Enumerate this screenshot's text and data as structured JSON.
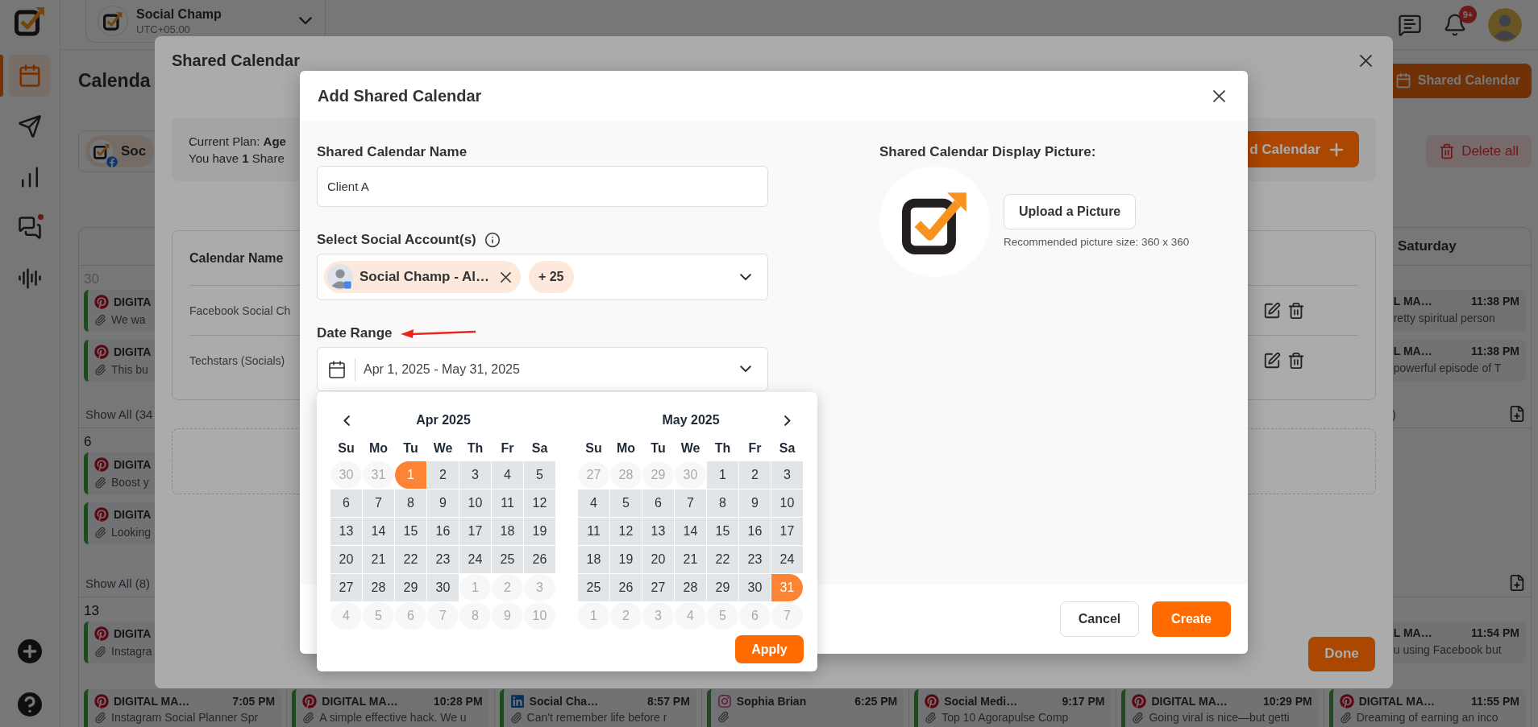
{
  "header": {
    "workspace_name": "Social Champ",
    "timezone": "UTC+05:00",
    "notification_count": "9+"
  },
  "sidebar": {
    "items": [
      {
        "selected": true,
        "unread": false
      },
      {
        "selected": false,
        "unread": false
      },
      {
        "selected": false,
        "unread": false
      },
      {
        "selected": false,
        "unread": true
      },
      {
        "selected": false,
        "unread": false
      }
    ]
  },
  "page": {
    "title": "Calenda",
    "shared_calendar_button": "Shared Calendar",
    "account_label": "Soc",
    "delete_all_button": "Delete all"
  },
  "calendar": {
    "weekday": "Saturday",
    "weeks": [
      {
        "day": "30",
        "outside": true,
        "cells": [
          {
            "posts": [
              {
                "kind": "pinterest",
                "title": "DIGITA",
                "text": "We wa"
              },
              {
                "kind": "pinterest",
                "title": "DIGITA",
                "text": "This bu"
              }
            ],
            "show_all": "Show All (34"
          },
          null,
          null,
          null,
          null,
          null,
          {
            "posts": [
              {
                "kind": "partial",
                "title": "L MA…",
                "time": "11:38 PM",
                "text": "retty spiritual person"
              },
              {
                "kind": "partial",
                "title": "L MA…",
                "time": "11:38 PM",
                "text": "powerful episode of T"
              }
            ],
            "show_all": ")",
            "add_post": true
          }
        ]
      },
      {
        "day": "6",
        "outside": false,
        "cells": [
          {
            "posts": [
              {
                "kind": "pinterest",
                "title": "DIGITA",
                "text": "Boost y"
              },
              {
                "kind": "pinterest",
                "title": "DIGITA",
                "text": "Looking"
              }
            ],
            "show_all": "Show All (8)"
          },
          null,
          null,
          null,
          null,
          null,
          {
            "add_post": true
          }
        ]
      },
      {
        "day": "13",
        "outside": false,
        "cells": [
          {
            "posts": [
              {
                "kind": "pinterest",
                "title": "DIGITA",
                "text": "Instagra"
              }
            ]
          },
          null,
          null,
          null,
          null,
          null,
          {
            "posts": [
              {
                "kind": "partial",
                "title": "L MA…",
                "time": "11:54 PM",
                "text": "u using Facebook but"
              }
            ]
          }
        ],
        "bottom_row": [
          {
            "kind": "pinterest",
            "title": "DIGITAL MA…",
            "time": "7:05 PM",
            "text": "Instagram Social Planner Spr"
          },
          {
            "kind": "pinterest",
            "title": "DIGITAL MA…",
            "time": "10:28 PM",
            "text": "A simple effective hack. We u"
          },
          {
            "kind": "linkedin",
            "title": "Social Cha…",
            "time": "8:57 PM",
            "text": "Can't remember life before r"
          },
          {
            "kind": "instagram",
            "title": "Sophia Brian",
            "time": "6:25 PM"
          },
          {
            "kind": "pinterest",
            "title": "Social Medi…",
            "time": "9:17 PM",
            "text": "Top 10 Agorapulse Comp"
          },
          {
            "kind": "pinterest",
            "title": "DIGITAL MA…",
            "time": "10:29 PM",
            "text": "Going viral is nice—but getti"
          },
          {
            "kind": "pinterest",
            "title": "DIGITAL MA…",
            "time": "11:55 PM",
            "text": "Dreaming of earning an inco"
          }
        ]
      }
    ]
  },
  "shared_calendar_modal": {
    "title": "Shared Calendar",
    "plan_text": "Current Plan: **Age**",
    "usage_text": "You have **1** Share",
    "add_button": "d Calendar",
    "table": {
      "header": "Calendar Name",
      "rows": [
        {
          "name": "Facebook Social Ch"
        },
        {
          "name": "Techstars (Socials)"
        }
      ]
    },
    "done_button": "Done"
  },
  "add_dialog": {
    "title": "Add Shared Calendar",
    "name_label": "Shared Calendar Name",
    "name_value": "Client A",
    "accounts_label": "Select Social Account(s)",
    "selected_account": "Social Champ - Al…",
    "more_accounts": "+ 25",
    "date_label": "Date Range",
    "date_value": "Apr 1, 2025 - May 31, 2025",
    "picture_label": "Shared Calendar Display Picture:",
    "upload_button": "Upload a Picture",
    "picture_hint": "Recommended picture size: 360 x 360",
    "cancel_button": "Cancel",
    "create_button": "Create",
    "date_picker": {
      "apply_button": "Apply",
      "months": [
        {
          "title": "Apr 2025",
          "weekdays": [
            "Su",
            "Mo",
            "Tu",
            "We",
            "Th",
            "Fr",
            "Sa"
          ],
          "days": [
            {
              "day": "30",
              "kind": "outside"
            },
            {
              "day": "31",
              "kind": "outside"
            },
            {
              "day": "1",
              "kind": "start"
            },
            {
              "day": "2",
              "kind": "range"
            },
            {
              "day": "3",
              "kind": "range"
            },
            {
              "day": "4",
              "kind": "range"
            },
            {
              "day": "5",
              "kind": "range"
            },
            {
              "day": "6",
              "kind": "range"
            },
            {
              "day": "7",
              "kind": "range"
            },
            {
              "day": "8",
              "kind": "range"
            },
            {
              "day": "9",
              "kind": "range"
            },
            {
              "day": "10",
              "kind": "range"
            },
            {
              "day": "11",
              "kind": "range"
            },
            {
              "day": "12",
              "kind": "range"
            },
            {
              "day": "13",
              "kind": "range"
            },
            {
              "day": "14",
              "kind": "range"
            },
            {
              "day": "15",
              "kind": "range"
            },
            {
              "day": "16",
              "kind": "range"
            },
            {
              "day": "17",
              "kind": "range"
            },
            {
              "day": "18",
              "kind": "range"
            },
            {
              "day": "19",
              "kind": "range"
            },
            {
              "day": "20",
              "kind": "range"
            },
            {
              "day": "21",
              "kind": "range"
            },
            {
              "day": "22",
              "kind": "range"
            },
            {
              "day": "23",
              "kind": "range"
            },
            {
              "day": "24",
              "kind": "range"
            },
            {
              "day": "25",
              "kind": "range"
            },
            {
              "day": "26",
              "kind": "range"
            },
            {
              "day": "27",
              "kind": "range"
            },
            {
              "day": "28",
              "kind": "range"
            },
            {
              "day": "29",
              "kind": "range"
            },
            {
              "day": "30",
              "kind": "range"
            },
            {
              "day": "1",
              "kind": "outside"
            },
            {
              "day": "2",
              "kind": "outside"
            },
            {
              "day": "3",
              "kind": "outside"
            },
            {
              "day": "4",
              "kind": "outside"
            },
            {
              "day": "5",
              "kind": "outside"
            },
            {
              "day": "6",
              "kind": "outside"
            },
            {
              "day": "7",
              "kind": "outside"
            },
            {
              "day": "8",
              "kind": "outside"
            },
            {
              "day": "9",
              "kind": "outside"
            },
            {
              "day": "10",
              "kind": "outside"
            }
          ]
        },
        {
          "title": "May 2025",
          "weekdays": [
            "Su",
            "Mo",
            "Tu",
            "We",
            "Th",
            "Fr",
            "Sa"
          ],
          "days": [
            {
              "day": "27",
              "kind": "outside"
            },
            {
              "day": "28",
              "kind": "outside"
            },
            {
              "day": "29",
              "kind": "outside"
            },
            {
              "day": "30",
              "kind": "outside"
            },
            {
              "day": "1",
              "kind": "range"
            },
            {
              "day": "2",
              "kind": "range"
            },
            {
              "day": "3",
              "kind": "range"
            },
            {
              "day": "4",
              "kind": "range"
            },
            {
              "day": "5",
              "kind": "range"
            },
            {
              "day": "6",
              "kind": "range"
            },
            {
              "day": "7",
              "kind": "range"
            },
            {
              "day": "8",
              "kind": "range"
            },
            {
              "day": "9",
              "kind": "range"
            },
            {
              "day": "10",
              "kind": "range"
            },
            {
              "day": "11",
              "kind": "range"
            },
            {
              "day": "12",
              "kind": "range"
            },
            {
              "day": "13",
              "kind": "range"
            },
            {
              "day": "14",
              "kind": "range"
            },
            {
              "day": "15",
              "kind": "range"
            },
            {
              "day": "16",
              "kind": "range"
            },
            {
              "day": "17",
              "kind": "range"
            },
            {
              "day": "18",
              "kind": "range"
            },
            {
              "day": "19",
              "kind": "range"
            },
            {
              "day": "20",
              "kind": "range"
            },
            {
              "day": "21",
              "kind": "range"
            },
            {
              "day": "22",
              "kind": "range"
            },
            {
              "day": "23",
              "kind": "range"
            },
            {
              "day": "24",
              "kind": "range"
            },
            {
              "day": "25",
              "kind": "range"
            },
            {
              "day": "26",
              "kind": "range"
            },
            {
              "day": "27",
              "kind": "range"
            },
            {
              "day": "28",
              "kind": "range"
            },
            {
              "day": "29",
              "kind": "range"
            },
            {
              "day": "30",
              "kind": "range"
            },
            {
              "day": "31",
              "kind": "end"
            },
            {
              "day": "1",
              "kind": "outside"
            },
            {
              "day": "2",
              "kind": "outside"
            },
            {
              "day": "3",
              "kind": "outside"
            },
            {
              "day": "4",
              "kind": "outside"
            },
            {
              "day": "5",
              "kind": "outside"
            },
            {
              "day": "6",
              "kind": "outside"
            },
            {
              "day": "7",
              "kind": "outside"
            }
          ]
        }
      ]
    }
  }
}
